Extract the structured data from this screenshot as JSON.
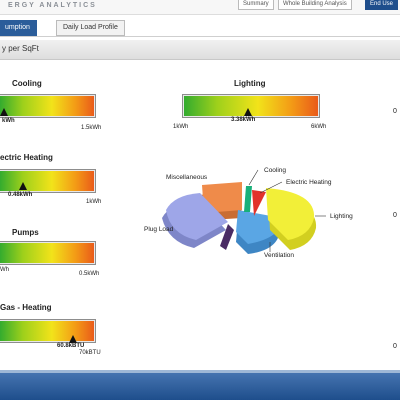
{
  "header": {
    "brand": "ERGY ANALYTICS",
    "buttons": [
      "Summary",
      "Whole Building Analysis",
      "End Use"
    ]
  },
  "tabs": [
    {
      "label": "umption",
      "active": true
    },
    {
      "label": "Daily Load Profile",
      "active": false
    }
  ],
  "section_title": "y per SqFt",
  "gauges": {
    "cooling": {
      "title": "Cooling",
      "current": "kWh",
      "max": "1.5kWh",
      "min": "",
      "level": 0.04
    },
    "electric_heating": {
      "title": "ectric Heating",
      "current": "0.48kWh",
      "max": "1kWh",
      "min": "",
      "level": 0.48
    },
    "pumps": {
      "title": "Pumps",
      "current": "",
      "max": "0.5kWh",
      "min": "Wh",
      "level": 0.0
    },
    "gas_heating": {
      "title": "Gas - Heating",
      "current": "60.8kBTU",
      "max": "70kBTU",
      "min": "",
      "level": 0.87
    },
    "lighting": {
      "title": "Lighting",
      "current": "3.38kWh",
      "max": "6kWh",
      "min": "1kWh",
      "level": 0.48
    }
  },
  "pie": {
    "labels": {
      "cooling": "Cooling",
      "electric_heating": "Electric Heating",
      "lighting": "Lighting",
      "ventilation": "Ventilation",
      "plug_load": "Plug Load",
      "miscellaneous": "Miscellaneous"
    },
    "colors": {
      "cooling": "#18b07a",
      "electric_heating": "#e2332b",
      "lighting": "#f2ef38",
      "ventilation": "#5aa6e4",
      "plug_load": "#9ea6e8",
      "miscellaneous": "#ef8b4a",
      "dark": "#4a2b64"
    }
  },
  "right_edge_values": [
    "0",
    "0",
    "0"
  ]
}
